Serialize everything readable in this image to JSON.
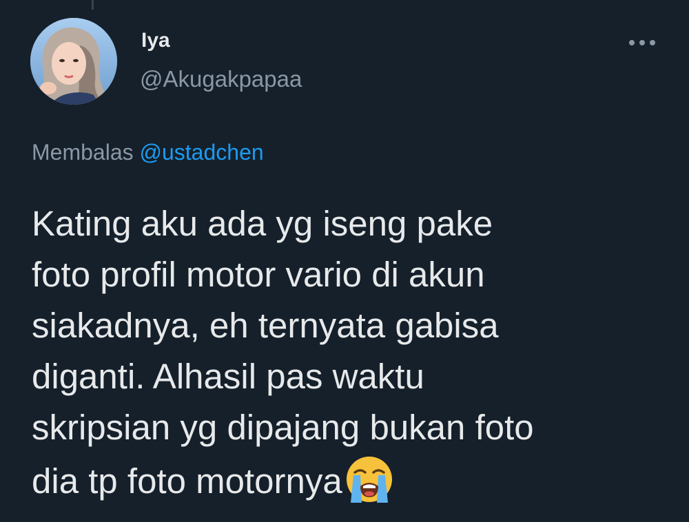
{
  "author": {
    "name": "Iya",
    "handle": "@Akugakpapaa",
    "avatar_icon": "profile-photo"
  },
  "menu": {
    "more_icon": "more-horizontal-icon"
  },
  "reply": {
    "prefix": "Membalas",
    "mention": "@ustadchen"
  },
  "tweet": {
    "lines": [
      "Kating aku ada yg iseng pake",
      "foto profil motor vario di akun",
      "siakadnya, eh ternyata gabisa",
      "diganti. Alhasil pas waktu",
      "skripsian yg dipajang bukan foto",
      "dia tp foto motornya"
    ],
    "emoji": "loudly-crying-face"
  },
  "colors": {
    "background": "#15202b",
    "text": "#e7e9ea",
    "secondary": "#8b98a5",
    "link": "#1d9bf0"
  }
}
